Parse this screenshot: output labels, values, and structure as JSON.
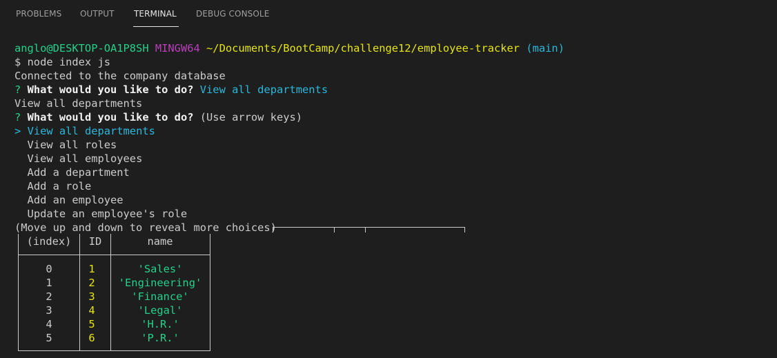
{
  "tabs": [
    {
      "label": "PROBLEMS"
    },
    {
      "label": "OUTPUT"
    },
    {
      "label": "TERMINAL"
    },
    {
      "label": "DEBUG CONSOLE"
    }
  ],
  "prompt": {
    "user_host": "anglo@DESKTOP-OA1P8SH",
    "shell": "MINGW64",
    "path": "~/Documents/BootCamp/challenge12/employee-tracker",
    "branch": "(main)"
  },
  "command": "$ node index js",
  "output_connected": "Connected to the company database",
  "question1": {
    "mark": "?",
    "text": "What would you like to do?",
    "answer": "View all departments"
  },
  "echo": "View all departments",
  "question2": {
    "mark": "?",
    "text": "What would you like to do?",
    "hint": "(Use arrow keys)"
  },
  "menu": {
    "pointer": ">",
    "items": [
      "View all departments",
      "View all roles",
      "View all employees",
      "Add a department",
      "Add a role",
      "Add an employee",
      "Update an employee's role"
    ]
  },
  "more_choices": "(Move up and down to reveal more choices)",
  "table": {
    "headers": [
      "(index)",
      "ID",
      "name"
    ],
    "rows": [
      {
        "index": "0",
        "id": "1",
        "name": "'Sales'"
      },
      {
        "index": "1",
        "id": "2",
        "name": "'Engineering'"
      },
      {
        "index": "2",
        "id": "3",
        "name": "'Finance'"
      },
      {
        "index": "3",
        "id": "4",
        "name": "'Legal'"
      },
      {
        "index": "4",
        "id": "5",
        "name": "'H.R.'"
      },
      {
        "index": "5",
        "id": "6",
        "name": "'P.R.'"
      }
    ]
  },
  "colors": {
    "background": "#1e1e1e",
    "green": "#23d18b",
    "magenta": "#bc3fbc",
    "yellow": "#e5e510",
    "cyan": "#29b8db",
    "text": "#cccccc"
  }
}
